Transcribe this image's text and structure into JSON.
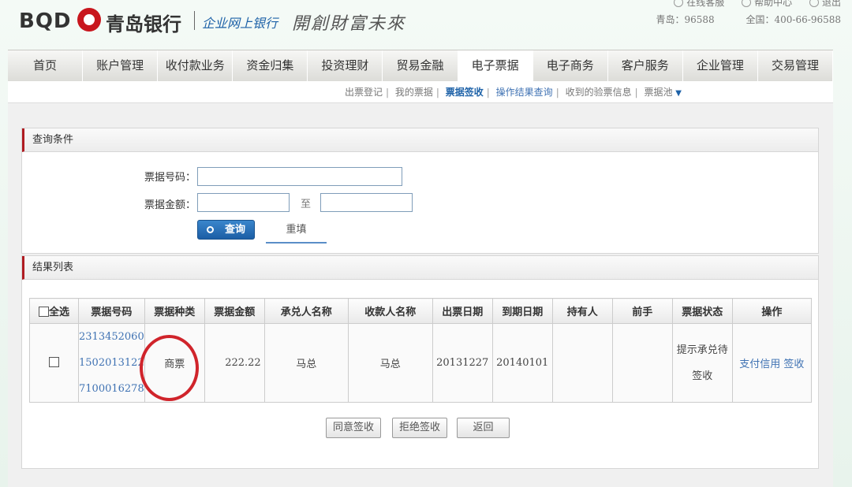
{
  "header": {
    "logo_text": "BQD",
    "bank_name": "青岛银行",
    "subtitle": "企业网上银行",
    "slogan": "開創財富未來",
    "top_links": [
      "在线客服",
      "帮助中心",
      "退出"
    ],
    "hotline_local": "青岛：96588",
    "hotline_national": "全国：400-66-96588"
  },
  "nav": {
    "tabs": [
      "首页",
      "账户管理",
      "收付款业务",
      "资金归集",
      "投资理财",
      "贸易金融",
      "电子票据",
      "电子商务",
      "客户服务",
      "企业管理",
      "交易管理"
    ]
  },
  "subnav": {
    "items": [
      "出票登记",
      "我的票据",
      "票据签收",
      "操作结果查询",
      "收到的验票信息",
      "票据池"
    ]
  },
  "query": {
    "title": "查询条件",
    "bill_no_label": "票据号码：",
    "amount_label": "票据金额：",
    "to_label": "至",
    "search_button": "查询",
    "reset_button": "重填"
  },
  "results": {
    "title": "结果列表",
    "select_all": "全选",
    "columns": [
      "票据号码",
      "票据种类",
      "票据金额",
      "承兑人名称",
      "收款人名称",
      "出票日期",
      "到期日期",
      "持有人",
      "前手",
      "票据状态",
      "操作"
    ],
    "row": {
      "bill_no": [
        "2313452060",
        "1502013122",
        "7100016278"
      ],
      "bill_type": "商票",
      "amount": "222.22",
      "acceptor": "马总",
      "payee": "马总",
      "issue_date": "20131227",
      "due_date": "20140101",
      "holder": "",
      "previous": "",
      "status_1": "提示承兑待",
      "status_2": "签收",
      "action_pay": "支付信用",
      "action_sign": "签收"
    }
  },
  "footer_buttons": {
    "agree": "同意签收",
    "reject": "拒绝签收",
    "back": "返回"
  },
  "colors": {
    "brand_red": "#c8161d",
    "link_blue": "#3f72b3",
    "annotation_circle": "#d0242b"
  }
}
